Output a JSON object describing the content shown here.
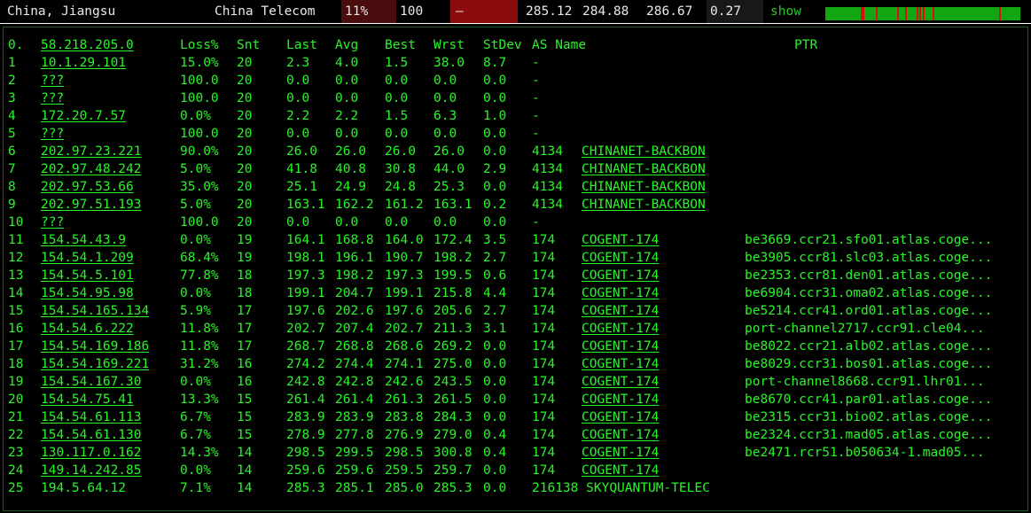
{
  "header": {
    "location": "China, Jiangsu",
    "isp": "China Telecom",
    "loss": "11%",
    "count": "100",
    "dash": "–",
    "last": "285.12",
    "avg": "284.88",
    "worst": "286.67",
    "stdev": "0.27",
    "show_label": "show",
    "colors": {
      "loss_bg": "#4a0c0c",
      "dash_bg": "#8a0c0c",
      "bar": "#12a612",
      "tick": "#d81010"
    },
    "timeline_fail_ticks": [
      0.18,
      0.19,
      0.26,
      0.37,
      0.41,
      0.47,
      0.48,
      0.5,
      0.55,
      0.89
    ]
  },
  "columns": {
    "hop": "0.",
    "host": "58.218.205.0",
    "loss": "Loss%",
    "snt": "Snt",
    "last": "Last",
    "avg": "Avg",
    "best": "Best",
    "wrst": "Wrst",
    "stdev": "StDev",
    "as": "AS Name",
    "ptr": "PTR"
  },
  "rows": [
    {
      "hop": "1",
      "host": "10.1.29.101",
      "loss": "15.0%",
      "snt": "20",
      "last": "2.3",
      "avg": "4.0",
      "best": "1.5",
      "wrst": "38.0",
      "stdev": "8.7",
      "asn": "",
      "asname": "",
      "as": "-",
      "ptr": ""
    },
    {
      "hop": "2",
      "host": "???",
      "loss": "100.0",
      "snt": "20",
      "last": "0.0",
      "avg": "0.0",
      "best": "0.0",
      "wrst": "0.0",
      "stdev": "0.0",
      "asn": "",
      "asname": "",
      "as": "-",
      "ptr": ""
    },
    {
      "hop": "3",
      "host": "???",
      "loss": "100.0",
      "snt": "20",
      "last": "0.0",
      "avg": "0.0",
      "best": "0.0",
      "wrst": "0.0",
      "stdev": "0.0",
      "asn": "",
      "asname": "",
      "as": "-",
      "ptr": ""
    },
    {
      "hop": "4",
      "host": "172.20.7.57",
      "loss": "0.0%",
      "snt": "20",
      "last": "2.2",
      "avg": "2.2",
      "best": "1.5",
      "wrst": "6.3",
      "stdev": "1.0",
      "asn": "",
      "asname": "",
      "as": "-",
      "ptr": ""
    },
    {
      "hop": "5",
      "host": "???",
      "loss": "100.0",
      "snt": "20",
      "last": "0.0",
      "avg": "0.0",
      "best": "0.0",
      "wrst": "0.0",
      "stdev": "0.0",
      "asn": "",
      "asname": "",
      "as": "-",
      "ptr": ""
    },
    {
      "hop": "6",
      "host": "202.97.23.221",
      "loss": "90.0%",
      "snt": "20",
      "last": "26.0",
      "avg": "26.0",
      "best": "26.0",
      "wrst": "26.0",
      "stdev": "0.0",
      "asn": "4134",
      "asname": "CHINANET-BACKBON",
      "as": "",
      "ptr": ""
    },
    {
      "hop": "7",
      "host": "202.97.48.242",
      "loss": "5.0%",
      "snt": "20",
      "last": "41.8",
      "avg": "40.8",
      "best": "30.8",
      "wrst": "44.0",
      "stdev": "2.9",
      "asn": "4134",
      "asname": "CHINANET-BACKBON",
      "as": "",
      "ptr": ""
    },
    {
      "hop": "8",
      "host": "202.97.53.66",
      "loss": "35.0%",
      "snt": "20",
      "last": "25.1",
      "avg": "24.9",
      "best": "24.8",
      "wrst": "25.3",
      "stdev": "0.0",
      "asn": "4134",
      "asname": "CHINANET-BACKBON",
      "as": "",
      "ptr": ""
    },
    {
      "hop": "9",
      "host": "202.97.51.193",
      "loss": "5.0%",
      "snt": "20",
      "last": "163.1",
      "avg": "162.2",
      "best": "161.2",
      "wrst": "163.1",
      "stdev": "0.2",
      "asn": "4134",
      "asname": "CHINANET-BACKBON",
      "as": "",
      "ptr": ""
    },
    {
      "hop": "10",
      "host": "???",
      "loss": "100.0",
      "snt": "20",
      "last": "0.0",
      "avg": "0.0",
      "best": "0.0",
      "wrst": "0.0",
      "stdev": "0.0",
      "asn": "",
      "asname": "",
      "as": "-",
      "ptr": ""
    },
    {
      "hop": "11",
      "host": "154.54.43.9",
      "loss": "0.0%",
      "snt": "19",
      "last": "164.1",
      "avg": "168.8",
      "best": "164.0",
      "wrst": "172.4",
      "stdev": "3.5",
      "asn": "174",
      "asname": "COGENT-174",
      "as": "",
      "ptr": "be3669.ccr21.sfo01.atlas.coge..."
    },
    {
      "hop": "12",
      "host": "154.54.1.209",
      "loss": "68.4%",
      "snt": "19",
      "last": "198.1",
      "avg": "196.1",
      "best": "190.7",
      "wrst": "198.2",
      "stdev": "2.7",
      "asn": "174",
      "asname": "COGENT-174",
      "as": "",
      "ptr": "be3905.ccr81.slc03.atlas.coge..."
    },
    {
      "hop": "13",
      "host": "154.54.5.101",
      "loss": "77.8%",
      "snt": "18",
      "last": "197.3",
      "avg": "198.2",
      "best": "197.3",
      "wrst": "199.5",
      "stdev": "0.6",
      "asn": "174",
      "asname": "COGENT-174",
      "as": "",
      "ptr": "be2353.ccr81.den01.atlas.coge..."
    },
    {
      "hop": "14",
      "host": "154.54.95.98",
      "loss": "0.0%",
      "snt": "18",
      "last": "199.1",
      "avg": "204.7",
      "best": "199.1",
      "wrst": "215.8",
      "stdev": "4.4",
      "asn": "174",
      "asname": "COGENT-174",
      "as": "",
      "ptr": "be6904.ccr31.oma02.atlas.coge..."
    },
    {
      "hop": "15",
      "host": "154.54.165.134",
      "loss": "5.9%",
      "snt": "17",
      "last": "197.6",
      "avg": "202.6",
      "best": "197.6",
      "wrst": "205.6",
      "stdev": "2.7",
      "asn": "174",
      "asname": "COGENT-174",
      "as": "",
      "ptr": "be5214.ccr41.ord01.atlas.coge..."
    },
    {
      "hop": "16",
      "host": "154.54.6.222",
      "loss": "11.8%",
      "snt": "17",
      "last": "202.7",
      "avg": "207.4",
      "best": "202.7",
      "wrst": "211.3",
      "stdev": "3.1",
      "asn": "174",
      "asname": "COGENT-174",
      "as": "",
      "ptr": "port-channel2717.ccr91.cle04..."
    },
    {
      "hop": "17",
      "host": "154.54.169.186",
      "loss": "11.8%",
      "snt": "17",
      "last": "268.7",
      "avg": "268.8",
      "best": "268.6",
      "wrst": "269.2",
      "stdev": "0.0",
      "asn": "174",
      "asname": "COGENT-174",
      "as": "",
      "ptr": "be8022.ccr21.alb02.atlas.coge..."
    },
    {
      "hop": "18",
      "host": "154.54.169.221",
      "loss": "31.2%",
      "snt": "16",
      "last": "274.2",
      "avg": "274.4",
      "best": "274.1",
      "wrst": "275.0",
      "stdev": "0.0",
      "asn": "174",
      "asname": "COGENT-174",
      "as": "",
      "ptr": "be8029.ccr31.bos01.atlas.coge..."
    },
    {
      "hop": "19",
      "host": "154.54.167.30",
      "loss": "0.0%",
      "snt": "16",
      "last": "242.8",
      "avg": "242.8",
      "best": "242.6",
      "wrst": "243.5",
      "stdev": "0.0",
      "asn": "174",
      "asname": "COGENT-174",
      "as": "",
      "ptr": "port-channel8668.ccr91.lhr01..."
    },
    {
      "hop": "20",
      "host": "154.54.75.41",
      "loss": "13.3%",
      "snt": "15",
      "last": "261.4",
      "avg": "261.4",
      "best": "261.3",
      "wrst": "261.5",
      "stdev": "0.0",
      "asn": "174",
      "asname": "COGENT-174",
      "as": "",
      "ptr": "be8670.ccr41.par01.atlas.coge..."
    },
    {
      "hop": "21",
      "host": "154.54.61.113",
      "loss": "6.7%",
      "snt": "15",
      "last": "283.9",
      "avg": "283.9",
      "best": "283.8",
      "wrst": "284.3",
      "stdev": "0.0",
      "asn": "174",
      "asname": "COGENT-174",
      "as": "",
      "ptr": "be2315.ccr31.bio02.atlas.coge..."
    },
    {
      "hop": "22",
      "host": "154.54.61.130",
      "loss": "6.7%",
      "snt": "15",
      "last": "278.9",
      "avg": "277.8",
      "best": "276.9",
      "wrst": "279.0",
      "stdev": "0.4",
      "asn": "174",
      "asname": "COGENT-174",
      "as": "",
      "ptr": "be2324.ccr31.mad05.atlas.coge..."
    },
    {
      "hop": "23",
      "host": "130.117.0.162",
      "loss": "14.3%",
      "snt": "14",
      "last": "298.5",
      "avg": "299.5",
      "best": "298.5",
      "wrst": "300.8",
      "stdev": "0.4",
      "asn": "174",
      "asname": "COGENT-174",
      "as": "",
      "ptr": "be2471.rcr51.b050634-1.mad05..."
    },
    {
      "hop": "24",
      "host": "149.14.242.85",
      "loss": "0.0%",
      "snt": "14",
      "last": "259.6",
      "avg": "259.6",
      "best": "259.5",
      "wrst": "259.7",
      "stdev": "0.0",
      "asn": "174",
      "asname": "COGENT-174",
      "as": "",
      "ptr": ""
    },
    {
      "hop": "25",
      "host": "194.5.64.12",
      "loss": "7.1%",
      "snt": "14",
      "last": "285.3",
      "avg": "285.1",
      "best": "285.0",
      "wrst": "285.3",
      "stdev": "0.0",
      "asn": "216138",
      "asname": "SKYQUANTUM-TELEC",
      "as": "",
      "ptr": "",
      "host_link": false,
      "as_link": false
    }
  ]
}
